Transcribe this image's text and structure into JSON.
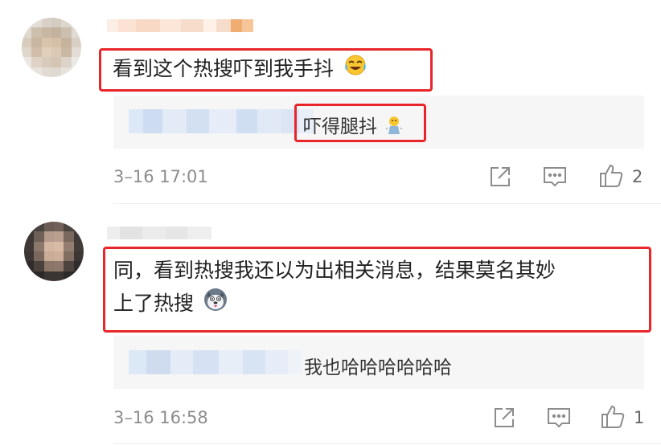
{
  "comments": [
    {
      "text": "看到这个热搜吓到我手抖",
      "emoji": "laugh-cry-emoji",
      "reply_text": "吓得腿抖",
      "reply_emoji": "trembling-emoji",
      "time": "3–16 17:01",
      "like_count": "2"
    },
    {
      "text_line1": "同，看到热搜我还以为出相关消息，结果莫名其妙",
      "text_line2": "上了热搜",
      "emoji": "husky-dog-emoji",
      "reply_text": "我也哈哈哈哈哈哈",
      "time": "3–16 16:58",
      "like_count": "1"
    }
  ],
  "colors": {
    "highlight": "#e8262a",
    "reply_bg": "#f6f6f7",
    "meta_text": "#8c8c8c"
  }
}
